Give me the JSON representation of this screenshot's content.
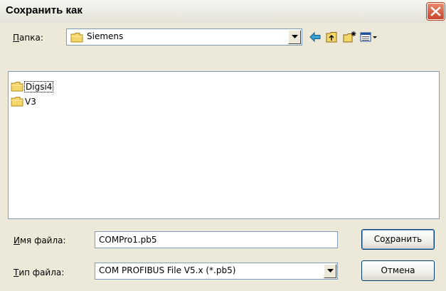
{
  "window": {
    "title": "Сохранить как",
    "close_icon": "close-icon"
  },
  "toolbar": {
    "folder_label_accel": "П",
    "folder_label_rest": "апка:",
    "folder_value": "Siemens",
    "icons": [
      "back-arrow-icon",
      "up-folder-icon",
      "new-folder-icon",
      "view-menu-icon"
    ]
  },
  "files": [
    {
      "name": "Digsi4",
      "icon": "folder-icon",
      "focused": true
    },
    {
      "name": "V3",
      "icon": "folder-icon",
      "focused": false
    }
  ],
  "filename": {
    "label_accel": "И",
    "label_rest": "мя файла:",
    "value": "COMPro1.pb5"
  },
  "filetype": {
    "label_accel": "Т",
    "label_rest": "ип файла:",
    "value": "COM PROFIBUS File V5.x (*.pb5)"
  },
  "buttons": {
    "save_pre": "Со",
    "save_accel": "х",
    "save_post": "ранить",
    "cancel": "Отмена"
  },
  "colors": {
    "title_bar": "#ece9d8",
    "close": "#c8452a",
    "border": "#7f9db9",
    "folder": "#f5d66b"
  }
}
